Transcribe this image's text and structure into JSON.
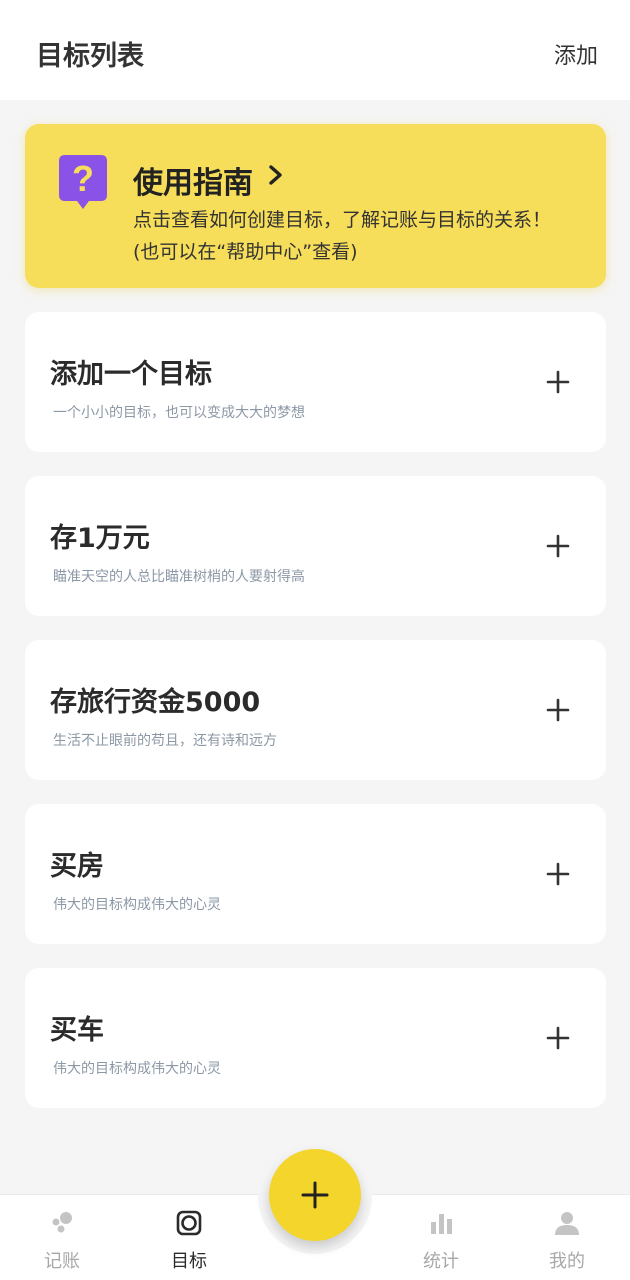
{
  "header": {
    "title": "目标列表",
    "add_label": "添加"
  },
  "guide": {
    "title": "使用指南",
    "line1": "点击查看如何创建目标，了解记账与目标的关系！",
    "line2": "(也可以在“帮助中心”查看)",
    "icon": "question-icon",
    "chevron_icon": "chevron-right-icon"
  },
  "goals": [
    {
      "name": "添加一个目标",
      "subtitle": "一个小小的目标，也可以变成大大的梦想"
    },
    {
      "name": "存1万元",
      "subtitle": "瞄准天空的人总比瞄准树梢的人要射得高"
    },
    {
      "name": "存旅行资金5000",
      "subtitle": "生活不止眼前的苟且，还有诗和远方"
    },
    {
      "name": "买房",
      "subtitle": "伟大的目标构成伟大的心灵"
    },
    {
      "name": "买车",
      "subtitle": "伟大的目标构成伟大的心灵"
    }
  ],
  "tabs": [
    {
      "label": "记账",
      "icon": "bookkeeping-icon",
      "active": false
    },
    {
      "label": "目标",
      "icon": "target-icon",
      "active": true
    },
    {
      "label": "统计",
      "icon": "bar-chart-icon",
      "active": false
    },
    {
      "label": "我的",
      "icon": "user-icon",
      "active": false
    }
  ],
  "colors": {
    "accent": "#f4d52c",
    "guide_bg": "#f6dd5a",
    "question_icon": "#8b52e8",
    "subtitle": "#8c98a6",
    "tab_inactive": "#a8a8a8"
  }
}
